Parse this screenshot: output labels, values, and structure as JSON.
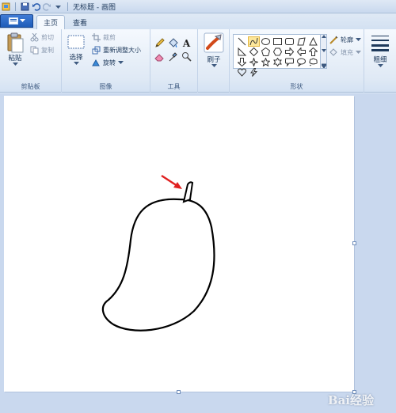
{
  "window": {
    "title": "无标题 - 画图",
    "quick_access_icons": [
      "paint-app-icon",
      "save-icon",
      "undo-icon",
      "redo-icon",
      "customize-icon"
    ]
  },
  "tabs": {
    "file_icon": "paint-menu-icon",
    "items": [
      {
        "label": "主页",
        "active": true
      },
      {
        "label": "查看",
        "active": false
      }
    ]
  },
  "ribbon": {
    "clipboard": {
      "paste": "粘贴",
      "cut": "剪切",
      "copy": "复制",
      "label": "剪贴板"
    },
    "image": {
      "select": "选择",
      "crop": "裁剪",
      "resize": "重新调整大小",
      "rotate": "旋转",
      "label": "图像"
    },
    "tools": {
      "text_tool": "A",
      "label": "工具",
      "items": [
        "pencil-icon",
        "fill-icon",
        "text-icon",
        "eraser-icon",
        "color-picker-icon",
        "magnifier-icon"
      ]
    },
    "brushes": {
      "label": "刷子"
    },
    "shapes": {
      "label": "形状",
      "outline": "轮廓",
      "fill": "填充",
      "items": [
        "line",
        "curve",
        "oval",
        "rectangle",
        "rounded-rectangle",
        "polygon",
        "triangle",
        "right-triangle",
        "diamond",
        "pentagon",
        "hexagon",
        "right-arrow",
        "left-arrow",
        "up-arrow",
        "down-arrow",
        "four-point-star",
        "five-point-star",
        "six-point-star",
        "rounded-callout",
        "oval-callout",
        "cloud-callout",
        "heart",
        "lightning"
      ]
    },
    "size": {
      "label": "粗细"
    }
  },
  "canvas": {
    "background": "#ffffff",
    "arrow_color": "#e02020",
    "stroke_color": "#000000"
  },
  "watermark": {
    "text": "Bai经验"
  }
}
